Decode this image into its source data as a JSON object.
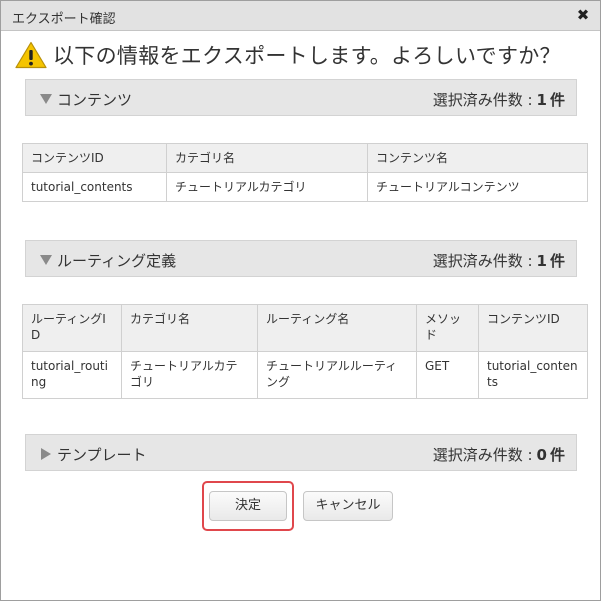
{
  "dialog": {
    "title": "エクスポート確認",
    "close_glyph": "✖",
    "question": "以下の情報をエクスポートします。よろしいですか？"
  },
  "sections": [
    {
      "name": "コンテンツ",
      "expanded": true,
      "count_label": "選択済み件数 :",
      "count": "1",
      "unit": "件",
      "table": {
        "headers": [
          "コンテンツID",
          "カテゴリ名",
          "コンテンツ名"
        ],
        "rows": [
          [
            "tutorial_contents",
            "チュートリアルカテゴリ",
            "チュートリアルコンテンツ"
          ]
        ]
      }
    },
    {
      "name": "ルーティング定義",
      "expanded": true,
      "count_label": "選択済み件数 :",
      "count": "1",
      "unit": "件",
      "table": {
        "headers": [
          "ルーティングID",
          "カテゴリ名",
          "ルーティング名",
          "メソッド",
          "コンテンツID"
        ],
        "rows": [
          [
            "tutorial_routing",
            "チュートリアルカテゴリ",
            "チュートリアルルーティング",
            "GET",
            "tutorial_contents"
          ]
        ]
      }
    },
    {
      "name": "テンプレート",
      "expanded": false,
      "count_label": "選択済み件数 :",
      "count": "0",
      "unit": "件"
    }
  ],
  "buttons": {
    "ok_label": "決定",
    "cancel_label": "キャンセル"
  },
  "icons": {
    "warning": "warning-icon",
    "expanded": "triangle-down-icon",
    "collapsed": "triangle-right-icon",
    "close": "close-icon"
  },
  "colors": {
    "warning_fill": "#f5c400",
    "triangle": "#8a8a8a",
    "highlight": "#e0474c"
  }
}
